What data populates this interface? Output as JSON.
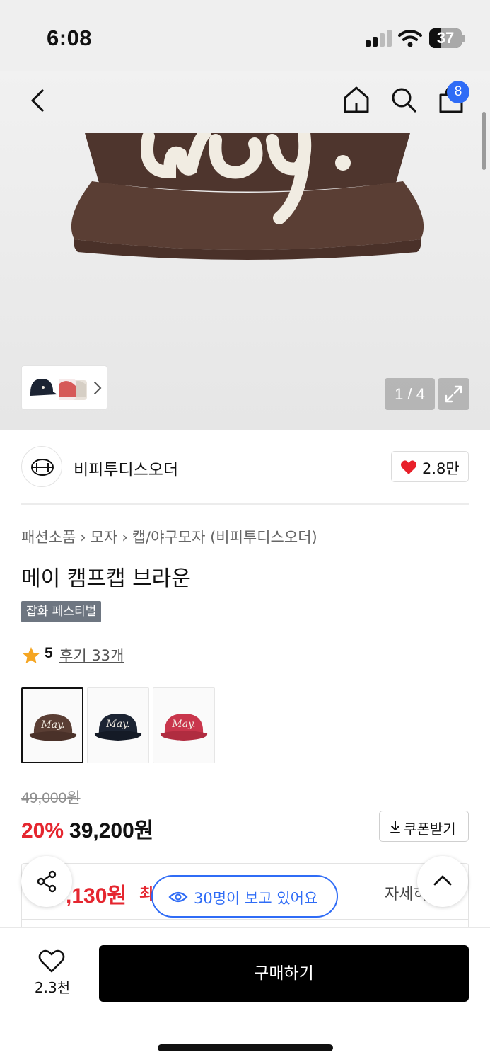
{
  "status_bar": {
    "time": "6:08",
    "battery": "37",
    "battery_level_percent": 37,
    "icons": [
      "signal-icon",
      "wifi-icon",
      "battery-icon"
    ]
  },
  "nav": {
    "icons": [
      "back-icon",
      "home-icon",
      "search-icon",
      "cart-icon"
    ],
    "cart_badge": "8"
  },
  "gallery": {
    "counter": "1 / 4",
    "colors": {
      "hat_brown": "#5a3e34",
      "hat_navy": "#1c2433",
      "hat_red": "#c9364c",
      "stitch": "#f1ece2"
    }
  },
  "brand": {
    "name": "비피투디스오더",
    "likes": "2.8만"
  },
  "breadcrumb": [
    "패션소품",
    "모자",
    "캡/야구모자 (비피투디스오더)"
  ],
  "product": {
    "title": "메이 캠프캡 브라운",
    "badge": "잡화 페스티벌",
    "rating": "5",
    "reviews": "후기 33개",
    "options": [
      {
        "name": "May.",
        "color": "#5a3e34",
        "selected": true
      },
      {
        "name": "May.",
        "color": "#1c2433",
        "selected": false
      },
      {
        "name": "May.",
        "color": "#c9364c",
        "selected": false
      }
    ]
  },
  "price": {
    "original": "49,000원",
    "discount": "20%",
    "sale": "39,200원",
    "coupon_label": "쿠폰받기",
    "max_benefit_price": ",130원",
    "max_benefit_label": "최",
    "detail_link": "자세히"
  },
  "floating": {
    "viewers": "30명이 보고 있어요"
  },
  "bottom": {
    "wish_count": "2.3천",
    "buy_label": "구매하기"
  },
  "theme": {
    "accent_blue": "#2f6cf6",
    "discount_red": "#e5262f",
    "heart_red": "#e8202a",
    "star_orange": "#f5a623"
  }
}
